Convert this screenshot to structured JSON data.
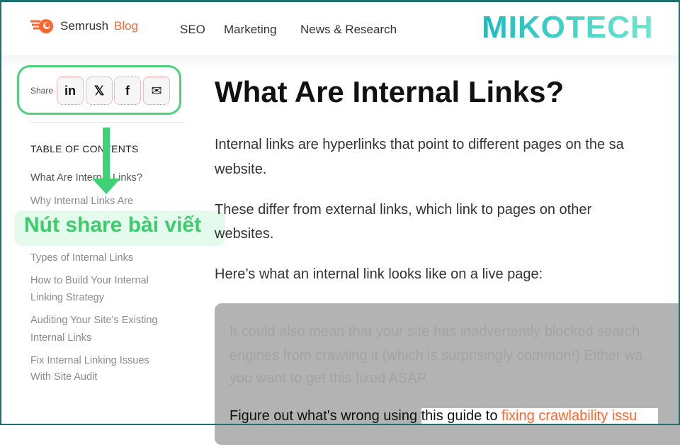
{
  "header": {
    "brand": "Semrush",
    "brand_suffix": "Blog",
    "nav": [
      "SEO",
      "Marketing",
      "News & Research"
    ],
    "watermark": "MIKOTECH"
  },
  "share": {
    "label": "Share",
    "buttons": [
      {
        "icon": "linkedin-icon",
        "glyph": "in"
      },
      {
        "icon": "x-icon",
        "glyph": "𝕏"
      },
      {
        "icon": "facebook-icon",
        "glyph": "f"
      },
      {
        "icon": "mail-icon",
        "glyph": "✉"
      }
    ]
  },
  "toc": {
    "title": "TABLE OF CONTENTS",
    "items": [
      "What Are Internal Links?",
      "Why Internal Links Are",
      "Types of Internal Links",
      "How to Build Your Internal",
      "Linking Strategy",
      "Auditing Your Site’s Existing",
      "Internal Links",
      "Fix Internal Linking Issues",
      "With Site Audit"
    ]
  },
  "annotation": {
    "label": "Nút share bài viết",
    "color": "#3fd173"
  },
  "article": {
    "title": "What Are Internal Links?",
    "p1": [
      "Internal links are hyperlinks that point to different pages on the sa",
      "website."
    ],
    "p2": [
      "These differ from external links, which link to pages on other",
      "websites."
    ],
    "p3": "Here’s what an internal link looks like on a live page:",
    "example": {
      "lines": [
        "It could also mean that your site has inadvertently blocked search",
        "engines from crawling it (which is surprisingly common!) Either wa",
        "you want to get this fixed ASAP."
      ],
      "last_prefix": "Figure out what's wrong using ",
      "last_highlight": "this guide to ",
      "link": "fixing crawlability issu"
    }
  },
  "colors": {
    "brand": "#ff642d",
    "accent": "#3fd173",
    "frame": "#1d6f6f"
  }
}
